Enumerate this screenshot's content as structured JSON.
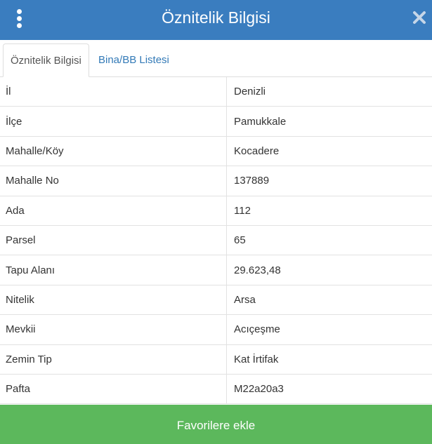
{
  "header": {
    "title": "Öznitelik Bilgisi",
    "menu_icon": "vertical-dots-icon",
    "close_icon": "close-icon",
    "bg_color": "#3a7dbf"
  },
  "tabs": [
    {
      "label": "Öznitelik Bilgisi",
      "active": true
    },
    {
      "label": "Bina/BB Listesi",
      "active": false
    }
  ],
  "attributes": [
    {
      "key": "İl",
      "value": "Denizli"
    },
    {
      "key": "İlçe",
      "value": "Pamukkale"
    },
    {
      "key": "Mahalle/Köy",
      "value": "Kocadere"
    },
    {
      "key": "Mahalle No",
      "value": "137889"
    },
    {
      "key": "Ada",
      "value": "112"
    },
    {
      "key": "Parsel",
      "value": "65"
    },
    {
      "key": "Tapu Alanı",
      "value": "29.623,48"
    },
    {
      "key": "Nitelik",
      "value": "Arsa"
    },
    {
      "key": "Mevkii",
      "value": "Acıçeşme"
    },
    {
      "key": "Zemin Tip",
      "value": "Kat İrtifak"
    },
    {
      "key": "Pafta",
      "value": "M22a20a3"
    }
  ],
  "footer": {
    "favorite_label": "Favorilere ekle",
    "bg_color": "#5cb85c"
  }
}
